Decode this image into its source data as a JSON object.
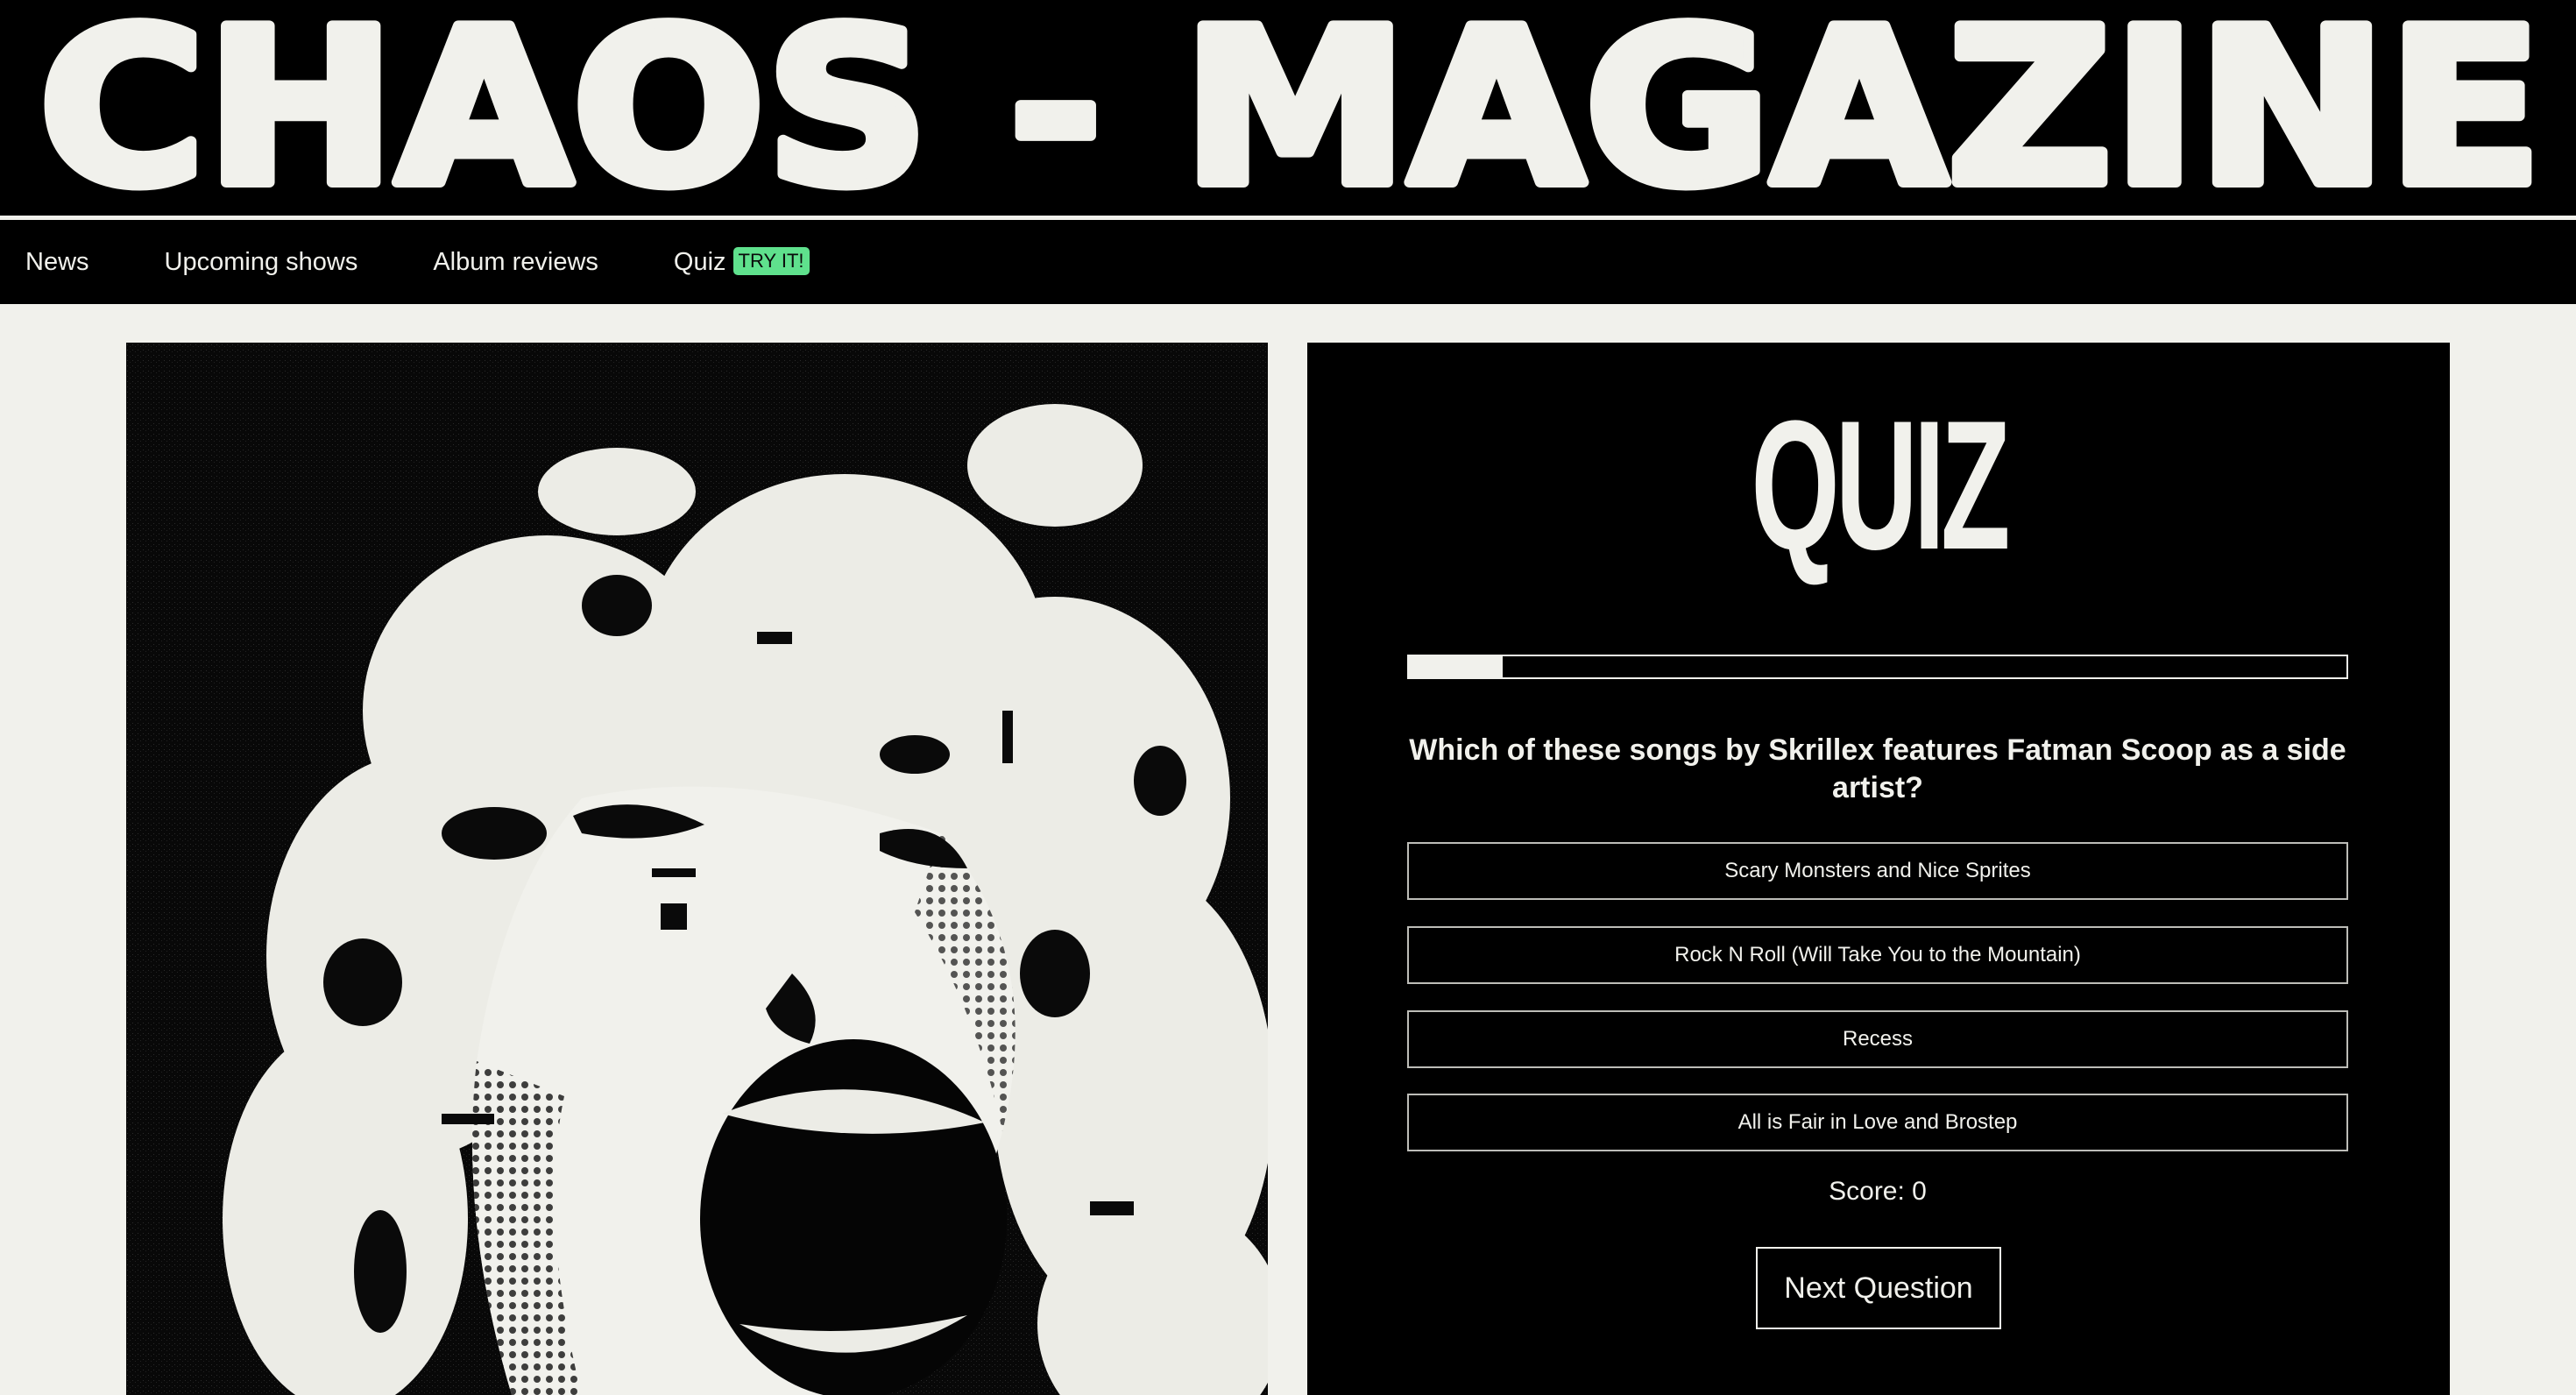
{
  "brand": {
    "title": "CHAOS - MAGAZINE"
  },
  "nav": {
    "items": [
      {
        "label": "News"
      },
      {
        "label": "Upcoming shows"
      },
      {
        "label": "Album reviews"
      },
      {
        "label": "Quiz",
        "badge": "TRY IT!"
      }
    ]
  },
  "hero": {
    "image_icon": "screaming-face-halftone-photo"
  },
  "quiz": {
    "title": "QUIZ",
    "progress": 0.1,
    "question": "Which of these songs by Skrillex features Fatman Scoop as a side artist?",
    "answers": [
      "Scary Monsters and Nice Sprites",
      "Rock N Roll (Will Take You to the Mountain)",
      "Recess",
      "All is Fair in Love and Brostep"
    ],
    "score_text": "Score: 0",
    "next_label": "Next Question"
  },
  "colors": {
    "background": "#f1f1ec",
    "ink": "#000000",
    "badge": "#5fe18d"
  }
}
